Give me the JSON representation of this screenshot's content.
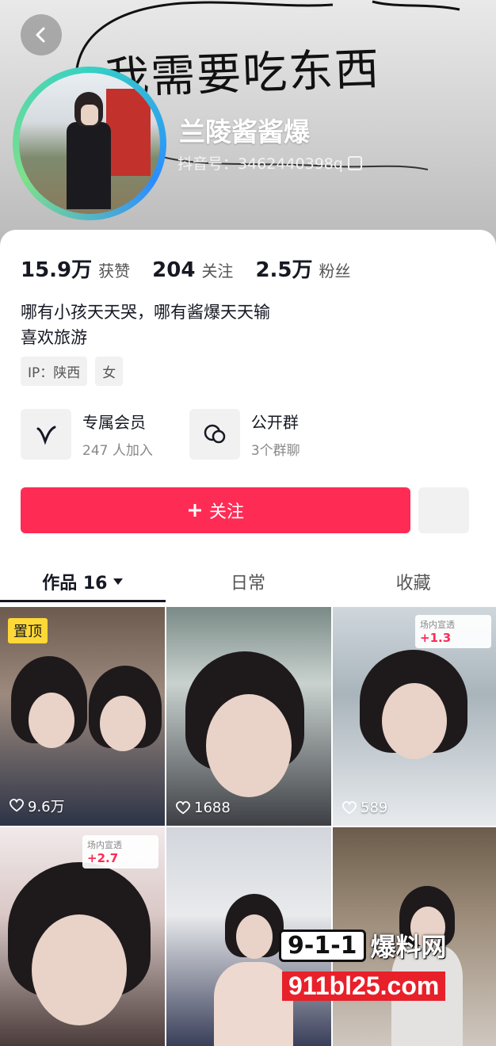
{
  "header": {
    "handwriting": "我需要吃东西",
    "username": "兰陵酱酱爆",
    "douyin_id": "抖音号：3462440398q"
  },
  "stats": [
    {
      "value": "15.9万",
      "label": "获赞"
    },
    {
      "value": "204",
      "label": "关注"
    },
    {
      "value": "2.5万",
      "label": "粉丝"
    }
  ],
  "bio": {
    "line1": "哪有小孩天天哭，哪有酱爆天天输",
    "line2": "喜欢旅游"
  },
  "tags": [
    "IP：陕西",
    "女"
  ],
  "features": [
    {
      "title": "专属会员",
      "subtitle": "247 人加入",
      "icon": "v-icon"
    },
    {
      "title": "公开群",
      "subtitle": "3个群聊",
      "icon": "chat-icon"
    }
  ],
  "follow_button": {
    "label": "关注",
    "color": "#fe2c55"
  },
  "tabs": [
    {
      "label": "作品 16",
      "active": true
    },
    {
      "label": "日常",
      "active": false
    },
    {
      "label": "收藏",
      "active": false
    }
  ],
  "videos": [
    {
      "likes": "9.6万",
      "pinned_label": "置顶"
    },
    {
      "likes": "1688"
    },
    {
      "likes": "589",
      "promo_label": "场内宣透",
      "promo_value": "+1.3"
    },
    {
      "likes": "",
      "promo_label": "场内宣透",
      "promo_value": "+2.7"
    },
    {
      "likes": ""
    },
    {
      "likes": ""
    }
  ],
  "watermark": {
    "badge": "9-1-1",
    "text": "爆料网",
    "url": "911bl25.com"
  }
}
